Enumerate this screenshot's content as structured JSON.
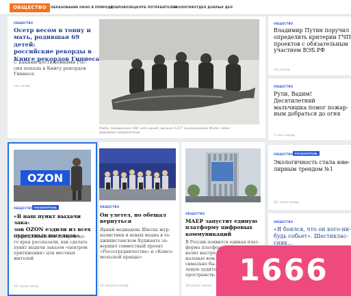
{
  "nav": {
    "logo": "ОБЩЕСТВО",
    "items": [
      "ОБРАЗОВАНИЕ",
      "ОКНО В ПРИРОДУ",
      "ДОБРОВОЛЕЦ",
      "КЛУБ ПОТРЕБИТЕЛЕЙ",
      "ЭКОЛОГИЯ",
      "ОТДЕЛ ДОБРЫХ ДЕЛ"
    ]
  },
  "featured": {
    "tag": "ОБЩЕСТВО",
    "title_lines": [
      "Осетр весом в тонну и",
      "мать, родившая 69 детей:",
      "российские рекорды в",
      "Книге рекордов Гиннеса"
    ],
    "lead_lines": [
      "С какими достижениями Рос-",
      "сия попала в Книгу рекордов",
      "Гиннеса"
    ],
    "time": "час назад",
    "caption_lines": [
      "Рыба, пойманная 100 лет назад, весила 1227 килограммов Фото: гене-",
      "рировано нейросетью"
    ]
  },
  "right": [
    {
      "tag": "ОБЩЕСТВО",
      "title_lines": [
        "Владимир Путин поручил",
        "определить критерии ГЧП-",
        "проектов с обязательным",
        "участием ВЭБ.РФ"
      ],
      "time": "час назад"
    },
    {
      "tag": "ОБЩЕСТВО",
      "title_lines": [
        "Рули, Вадим! Десятилетний",
        "мальчишка помог пожар-",
        "ным добраться до огня"
      ],
      "time": "3 часа назад"
    },
    {
      "tag": "ОБЩЕСТВО",
      "tag2": "РОСКОНТРОЛЬ",
      "title_lines": [
        "Экологичность стала юве-",
        "лирным трендом №1"
      ],
      "time": "16 часов назад"
    },
    {
      "tag": "ОБЩЕСТВО",
      "title_lines": [
        "«Я боялся, что он кого-ни-",
        "будь собьет». Шестиклас-",
        "сник..."
      ]
    }
  ],
  "bottom": [
    {
      "tag": "ОБЩЕСТВО",
      "tag2": "РОСКОНТРОЛЬ",
      "photo_text": "OZON",
      "title_lines": [
        "«В наш пункт выдачи зака-",
        "зов OZON ездили из всех",
        "окрестных поселков»"
      ],
      "lead_lines": [
        "Предприниматели Хабаровско-",
        "го края рассказали, как сделать",
        "пункт выдачи заказов «центром",
        "притяжения» для местных",
        "жителей"
      ],
      "time": "16 часов назад"
    },
    {
      "tag": "ОБЩЕСТВО",
      "title_lines": [
        "Он улетел, но обещал",
        "вернуться"
      ],
      "lead_lines": [
        "Яркий медиадень Школы жур-",
        "налистики и новых медиа в та-",
        "джикистанском Худжанте за-",
        "вершил совместный проект",
        "«Россотрудничества» и «Комсо-",
        "мольской правды»"
      ],
      "time": "42 минуты назад"
    },
    {
      "tag": "ОБЩЕСТВО",
      "title_lines": [
        "МАЕР запустит единую",
        "платформу цифровых",
        "коммуникаций"
      ],
      "lead_lines": [
        "В России появится единая плат-",
        "форма платформ для...",
        "волит выстро...",
        "нальные ком...",
        "симально бы...",
        "левую аудито...",
        "пространств..."
      ],
      "time": "29 минут назад"
    }
  ],
  "overlay": {
    "number": "1666"
  },
  "colors": {
    "accent": "#f4721f",
    "link": "#2a5bd7",
    "selection": "#1f6fe0",
    "badge": "#ef4a7d"
  }
}
